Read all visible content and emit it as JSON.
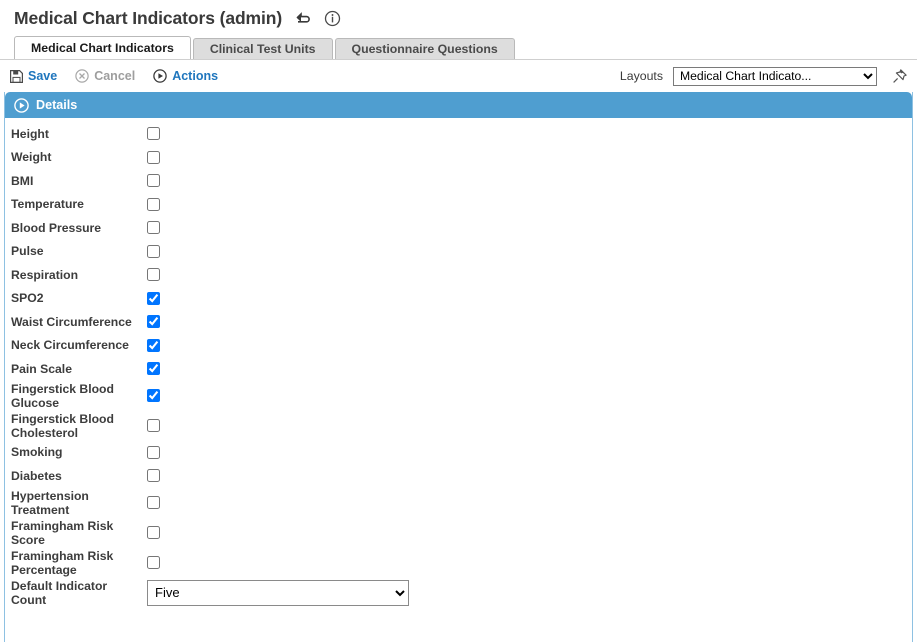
{
  "header": {
    "title": "Medical Chart Indicators (admin)",
    "icons": [
      {
        "name": "return-arrow-icon",
        "glyph": "return-arrow"
      },
      {
        "name": "info-circle-icon",
        "glyph": "info-circle"
      }
    ]
  },
  "tabs": [
    {
      "label": "Medical Chart Indicators",
      "active": true
    },
    {
      "label": "Clinical Test Units",
      "active": false
    },
    {
      "label": "Questionnaire Questions",
      "active": false
    }
  ],
  "toolbar": {
    "save_label": "Save",
    "cancel_label": "Cancel",
    "actions_label": "Actions",
    "layouts_label": "Layouts",
    "layout_selected": "Medical Chart Indicato...",
    "layout_options": [
      "Medical Chart Indicato..."
    ],
    "pin_icon": "pushpin-icon"
  },
  "panel": {
    "title": "Details",
    "expander_icon": "play-circle-icon"
  },
  "fields": [
    {
      "label": "Height",
      "type": "checkbox",
      "checked": false
    },
    {
      "label": "Weight",
      "type": "checkbox",
      "checked": false
    },
    {
      "label": "BMI",
      "type": "checkbox",
      "checked": false
    },
    {
      "label": "Temperature",
      "type": "checkbox",
      "checked": false
    },
    {
      "label": "Blood Pressure",
      "type": "checkbox",
      "checked": false
    },
    {
      "label": "Pulse",
      "type": "checkbox",
      "checked": false
    },
    {
      "label": "Respiration",
      "type": "checkbox",
      "checked": false
    },
    {
      "label": "SPO2",
      "type": "checkbox",
      "checked": true
    },
    {
      "label": "Waist Circumference",
      "type": "checkbox",
      "checked": true
    },
    {
      "label": "Neck Circumference",
      "type": "checkbox",
      "checked": true
    },
    {
      "label": "Pain Scale",
      "type": "checkbox",
      "checked": true
    },
    {
      "label": "Fingerstick Blood Glucose",
      "type": "checkbox",
      "checked": true
    },
    {
      "label": "Fingerstick Blood Cholesterol",
      "type": "checkbox",
      "checked": false
    },
    {
      "label": "Smoking",
      "type": "checkbox",
      "checked": false
    },
    {
      "label": "Diabetes",
      "type": "checkbox",
      "checked": false
    },
    {
      "label": "Hypertension Treatment",
      "type": "checkbox",
      "checked": false
    },
    {
      "label": "Framingham Risk Score",
      "type": "checkbox",
      "checked": false
    },
    {
      "label": "Framingham Risk Percentage",
      "type": "checkbox",
      "checked": false
    },
    {
      "label": "Default Indicator Count",
      "type": "select",
      "value": "Five",
      "options": [
        "Five"
      ]
    }
  ],
  "colors": {
    "panel_blue": "#4f9ed0",
    "panel_border": "#8ec1e2",
    "link_blue": "#1f76bd",
    "disabled_gray": "#9e9e9e"
  }
}
